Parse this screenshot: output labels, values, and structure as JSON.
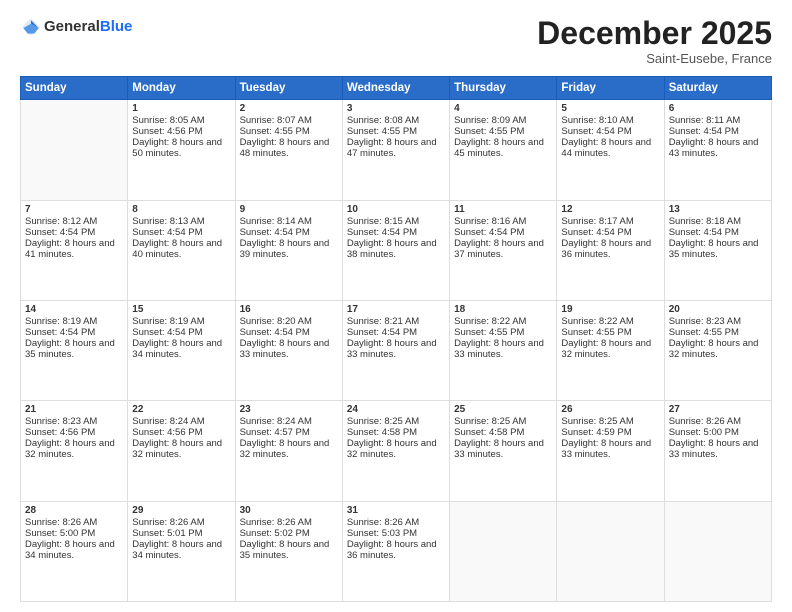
{
  "header": {
    "logo_general": "General",
    "logo_blue": "Blue",
    "month": "December 2025",
    "location": "Saint-Eusebe, France"
  },
  "days_of_week": [
    "Sunday",
    "Monday",
    "Tuesday",
    "Wednesday",
    "Thursday",
    "Friday",
    "Saturday"
  ],
  "weeks": [
    [
      {
        "day": "",
        "sunrise": "",
        "sunset": "",
        "daylight": "",
        "empty": true
      },
      {
        "day": "1",
        "sunrise": "Sunrise: 8:05 AM",
        "sunset": "Sunset: 4:56 PM",
        "daylight": "Daylight: 8 hours and 50 minutes."
      },
      {
        "day": "2",
        "sunrise": "Sunrise: 8:07 AM",
        "sunset": "Sunset: 4:55 PM",
        "daylight": "Daylight: 8 hours and 48 minutes."
      },
      {
        "day": "3",
        "sunrise": "Sunrise: 8:08 AM",
        "sunset": "Sunset: 4:55 PM",
        "daylight": "Daylight: 8 hours and 47 minutes."
      },
      {
        "day": "4",
        "sunrise": "Sunrise: 8:09 AM",
        "sunset": "Sunset: 4:55 PM",
        "daylight": "Daylight: 8 hours and 45 minutes."
      },
      {
        "day": "5",
        "sunrise": "Sunrise: 8:10 AM",
        "sunset": "Sunset: 4:54 PM",
        "daylight": "Daylight: 8 hours and 44 minutes."
      },
      {
        "day": "6",
        "sunrise": "Sunrise: 8:11 AM",
        "sunset": "Sunset: 4:54 PM",
        "daylight": "Daylight: 8 hours and 43 minutes."
      }
    ],
    [
      {
        "day": "7",
        "sunrise": "Sunrise: 8:12 AM",
        "sunset": "Sunset: 4:54 PM",
        "daylight": "Daylight: 8 hours and 41 minutes."
      },
      {
        "day": "8",
        "sunrise": "Sunrise: 8:13 AM",
        "sunset": "Sunset: 4:54 PM",
        "daylight": "Daylight: 8 hours and 40 minutes."
      },
      {
        "day": "9",
        "sunrise": "Sunrise: 8:14 AM",
        "sunset": "Sunset: 4:54 PM",
        "daylight": "Daylight: 8 hours and 39 minutes."
      },
      {
        "day": "10",
        "sunrise": "Sunrise: 8:15 AM",
        "sunset": "Sunset: 4:54 PM",
        "daylight": "Daylight: 8 hours and 38 minutes."
      },
      {
        "day": "11",
        "sunrise": "Sunrise: 8:16 AM",
        "sunset": "Sunset: 4:54 PM",
        "daylight": "Daylight: 8 hours and 37 minutes."
      },
      {
        "day": "12",
        "sunrise": "Sunrise: 8:17 AM",
        "sunset": "Sunset: 4:54 PM",
        "daylight": "Daylight: 8 hours and 36 minutes."
      },
      {
        "day": "13",
        "sunrise": "Sunrise: 8:18 AM",
        "sunset": "Sunset: 4:54 PM",
        "daylight": "Daylight: 8 hours and 35 minutes."
      }
    ],
    [
      {
        "day": "14",
        "sunrise": "Sunrise: 8:19 AM",
        "sunset": "Sunset: 4:54 PM",
        "daylight": "Daylight: 8 hours and 35 minutes."
      },
      {
        "day": "15",
        "sunrise": "Sunrise: 8:19 AM",
        "sunset": "Sunset: 4:54 PM",
        "daylight": "Daylight: 8 hours and 34 minutes."
      },
      {
        "day": "16",
        "sunrise": "Sunrise: 8:20 AM",
        "sunset": "Sunset: 4:54 PM",
        "daylight": "Daylight: 8 hours and 33 minutes."
      },
      {
        "day": "17",
        "sunrise": "Sunrise: 8:21 AM",
        "sunset": "Sunset: 4:54 PM",
        "daylight": "Daylight: 8 hours and 33 minutes."
      },
      {
        "day": "18",
        "sunrise": "Sunrise: 8:22 AM",
        "sunset": "Sunset: 4:55 PM",
        "daylight": "Daylight: 8 hours and 33 minutes."
      },
      {
        "day": "19",
        "sunrise": "Sunrise: 8:22 AM",
        "sunset": "Sunset: 4:55 PM",
        "daylight": "Daylight: 8 hours and 32 minutes."
      },
      {
        "day": "20",
        "sunrise": "Sunrise: 8:23 AM",
        "sunset": "Sunset: 4:55 PM",
        "daylight": "Daylight: 8 hours and 32 minutes."
      }
    ],
    [
      {
        "day": "21",
        "sunrise": "Sunrise: 8:23 AM",
        "sunset": "Sunset: 4:56 PM",
        "daylight": "Daylight: 8 hours and 32 minutes."
      },
      {
        "day": "22",
        "sunrise": "Sunrise: 8:24 AM",
        "sunset": "Sunset: 4:56 PM",
        "daylight": "Daylight: 8 hours and 32 minutes."
      },
      {
        "day": "23",
        "sunrise": "Sunrise: 8:24 AM",
        "sunset": "Sunset: 4:57 PM",
        "daylight": "Daylight: 8 hours and 32 minutes."
      },
      {
        "day": "24",
        "sunrise": "Sunrise: 8:25 AM",
        "sunset": "Sunset: 4:58 PM",
        "daylight": "Daylight: 8 hours and 32 minutes."
      },
      {
        "day": "25",
        "sunrise": "Sunrise: 8:25 AM",
        "sunset": "Sunset: 4:58 PM",
        "daylight": "Daylight: 8 hours and 33 minutes."
      },
      {
        "day": "26",
        "sunrise": "Sunrise: 8:25 AM",
        "sunset": "Sunset: 4:59 PM",
        "daylight": "Daylight: 8 hours and 33 minutes."
      },
      {
        "day": "27",
        "sunrise": "Sunrise: 8:26 AM",
        "sunset": "Sunset: 5:00 PM",
        "daylight": "Daylight: 8 hours and 33 minutes."
      }
    ],
    [
      {
        "day": "28",
        "sunrise": "Sunrise: 8:26 AM",
        "sunset": "Sunset: 5:00 PM",
        "daylight": "Daylight: 8 hours and 34 minutes."
      },
      {
        "day": "29",
        "sunrise": "Sunrise: 8:26 AM",
        "sunset": "Sunset: 5:01 PM",
        "daylight": "Daylight: 8 hours and 34 minutes."
      },
      {
        "day": "30",
        "sunrise": "Sunrise: 8:26 AM",
        "sunset": "Sunset: 5:02 PM",
        "daylight": "Daylight: 8 hours and 35 minutes."
      },
      {
        "day": "31",
        "sunrise": "Sunrise: 8:26 AM",
        "sunset": "Sunset: 5:03 PM",
        "daylight": "Daylight: 8 hours and 36 minutes."
      },
      {
        "day": "",
        "sunrise": "",
        "sunset": "",
        "daylight": "",
        "empty": true
      },
      {
        "day": "",
        "sunrise": "",
        "sunset": "",
        "daylight": "",
        "empty": true
      },
      {
        "day": "",
        "sunrise": "",
        "sunset": "",
        "daylight": "",
        "empty": true
      }
    ]
  ]
}
